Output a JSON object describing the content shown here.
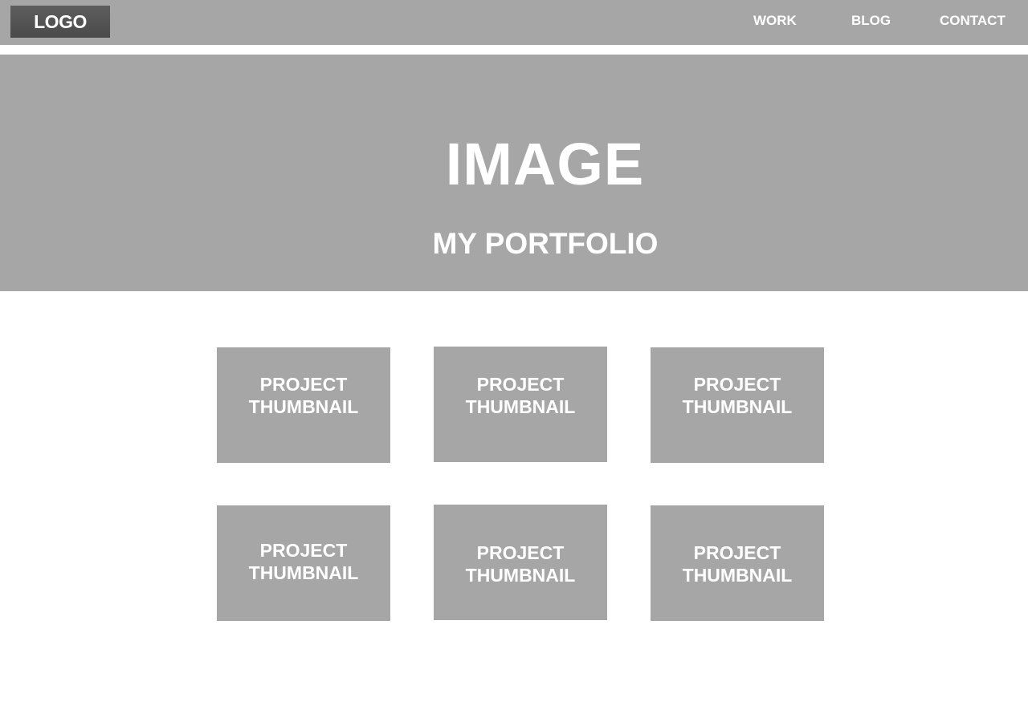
{
  "header": {
    "logo": "LOGO",
    "nav": [
      {
        "label": "WORK"
      },
      {
        "label": "BLOG"
      },
      {
        "label": "CONTACT"
      }
    ]
  },
  "hero": {
    "image_label": "IMAGE",
    "title": "MY PORTFOLIO"
  },
  "projects": [
    {
      "line1": "PROJECT",
      "line2": "THUMBNAIL"
    },
    {
      "line1": "PROJECT",
      "line2": "THUMBNAIL"
    },
    {
      "line1": "PROJECT",
      "line2": "THUMBNAIL"
    },
    {
      "line1": "PROJECT",
      "line2": "THUMBNAIL"
    },
    {
      "line1": "PROJECT",
      "line2": "THUMBNAIL"
    },
    {
      "line1": "PROJECT",
      "line2": "THUMBNAIL"
    }
  ],
  "colors": {
    "panel": "#a6a6a6",
    "logo_bg": "#555555",
    "text": "#ffffff"
  }
}
